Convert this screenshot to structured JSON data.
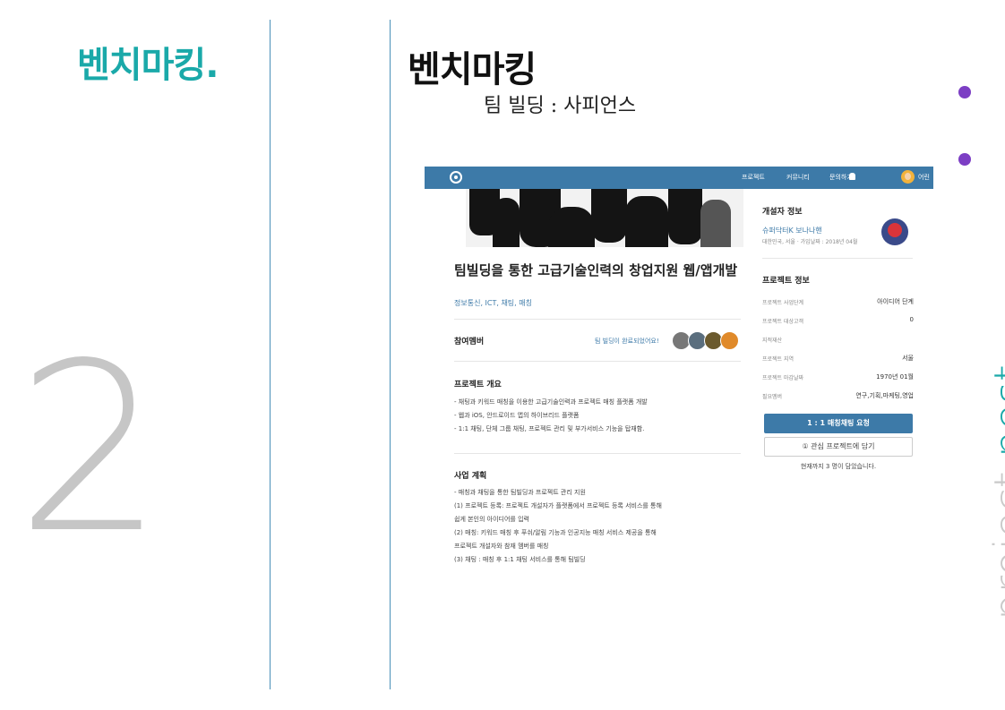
{
  "side": {
    "title": "벤치마킹.",
    "number": "2"
  },
  "slide": {
    "title": "벤치마킹",
    "subtitle": "팀 빌딩 : 사피언스"
  },
  "vertical_label": {
    "plain": "project ",
    "accent": "nest"
  },
  "colors": {
    "accent": "#1aa9a9",
    "nav": "#3d7aa8",
    "dot": "#7c3ec4"
  },
  "screenshot": {
    "nav": {
      "items": [
        "프로젝트",
        "커뮤니티",
        "문의하기"
      ],
      "bell_icon": "bell-icon",
      "user": "어린"
    },
    "project": {
      "title": "팀빌딩을 통한 고급기술인력의 창업지원 웹/앱개발",
      "tags": "정보통신, ICT, 채팅, 매칭"
    },
    "members": {
      "label": "참여멤버",
      "note": "팀 빌딩이 완료되었어요!"
    },
    "overview": {
      "title": "프로젝트 개요",
      "lines": [
        "- 채팅과 키워드 매칭을 이용한 고급기술인력과 프로젝트 매칭 플랫폼 개발",
        "- 웹과 iOS, 안드로이드 앱의 하이브리드 플랫폼",
        "- 1:1 채팅, 단체 그룹 채팅, 프로젝트 관리 및 부가서비스 기능을 탑재함."
      ]
    },
    "plan": {
      "title": "사업 계획",
      "lines": [
        "- 매칭과 채팅을 통한 팀빌딩과 프로젝트 관리 지원",
        "(1) 프로젝트 등록: 프로젝트 개설자가 플랫폼에서 프로젝트 등록 서비스를 통해",
        "쉽게 본인의 아이디어를 입력",
        "(2) 매칭: 키워드 매칭 후 푸쉬/알림 기능과 인공지능 매칭 서비스 제공을 통해",
        "프로젝트 개설자와 참재 멤버를 매칭",
        "(3) 채팅 : 매칭 후 1:1 채팅 서비스를 통해 팀빌딩"
      ]
    },
    "developer": {
      "title": "개설자 정보",
      "name": "슈퍼닥터K 보나나핸",
      "location": "대한민국, 서울 · 가입날짜 : 2018년 04월"
    },
    "project_info": {
      "title": "프로젝트 정보",
      "rows": [
        {
          "label": "프로젝트 사업단계",
          "value": "아이디어 단계"
        },
        {
          "label": "프로젝트 대상고객",
          "value": "0"
        },
        {
          "label": "지적재산",
          "value": ""
        },
        {
          "label": "프로젝트 지역",
          "value": "서울"
        },
        {
          "label": "프로젝트 마감날짜",
          "value": "1970년 01월"
        },
        {
          "label": "필요멤버",
          "value": "연구,기획,마케팅,영업"
        }
      ]
    },
    "buttons": {
      "match": "1 : 1 매칭채팅 요청",
      "favorite": "① 관심 프로젝트에 담기"
    },
    "fav_count": "현재까지 3 명이 담았습니다."
  }
}
